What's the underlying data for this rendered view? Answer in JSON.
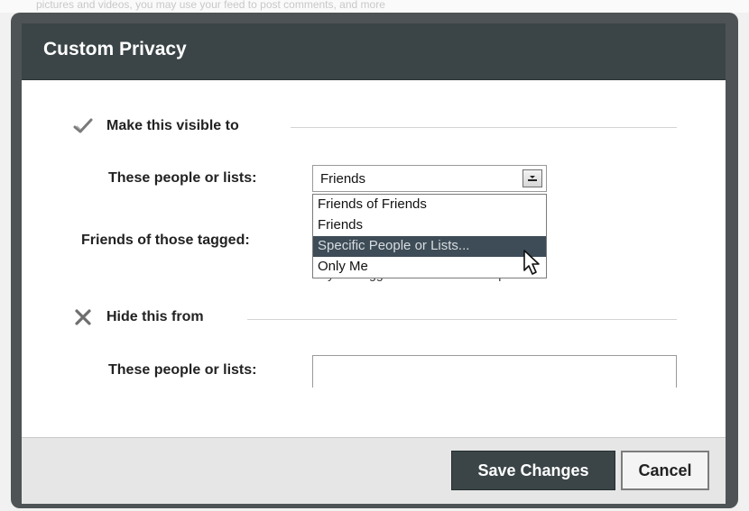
{
  "background": {
    "faint_text": "pictures and videos, you may use your feed to post comments, and more"
  },
  "dialog": {
    "title": "Custom Privacy"
  },
  "visible_section": {
    "heading": "Make this visible to",
    "icon": "checkmark-icon",
    "people_label": "These people or lists:",
    "selected_value": "Friends",
    "options": [
      "Friends of Friends",
      "Friends",
      "Specific People or Lists...",
      "Only Me"
    ],
    "highlighted_option": "Specific People or Lists...",
    "tagged_label": "Friends of those tagged:",
    "tagged_hint": "Anyone tagged can also see this post."
  },
  "hide_section": {
    "heading": "Hide this from",
    "icon": "x-icon",
    "people_label": "These people or lists:",
    "input_value": ""
  },
  "footer": {
    "save_label": "Save Changes",
    "cancel_label": "Cancel"
  },
  "colors": {
    "titlebar": "#3b4547",
    "highlight": "#3d4c57",
    "footer": "#e6e6e6"
  }
}
